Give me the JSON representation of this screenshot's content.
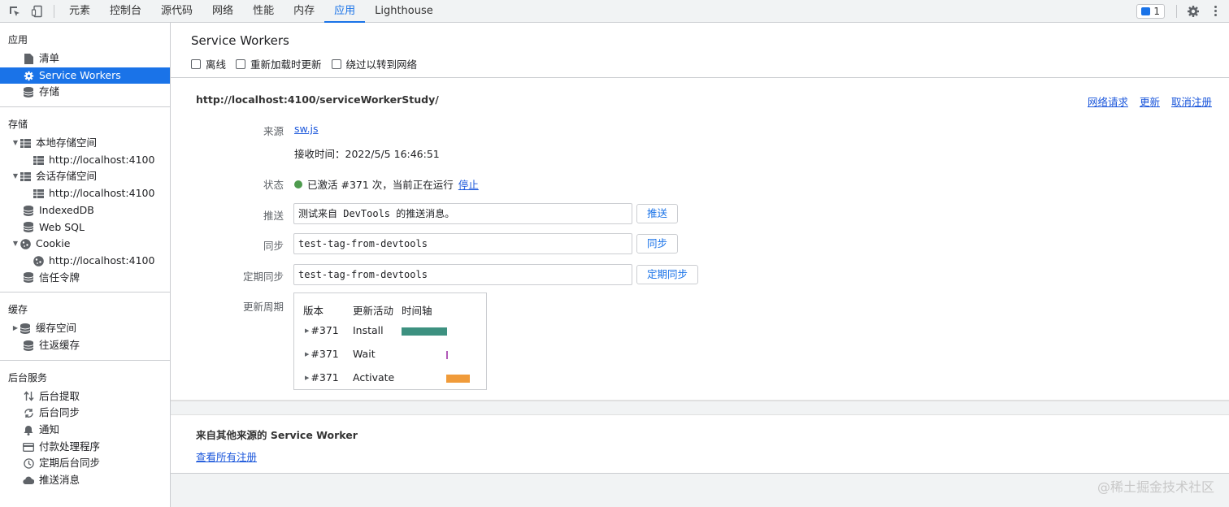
{
  "toolbar": {
    "tabs": [
      "元素",
      "控制台",
      "源代码",
      "网络",
      "性能",
      "内存",
      "应用",
      "Lighthouse"
    ],
    "active_tab": "应用",
    "issues_count": "1"
  },
  "sidebar": {
    "app_title": "应用",
    "app_items": [
      "清单",
      "Service Workers",
      "存储"
    ],
    "storage_title": "存储",
    "local_storage": "本地存储空间",
    "local_storage_child": "http://localhost:4100",
    "session_storage": "会话存储空间",
    "session_storage_child": "http://localhost:4100",
    "indexeddb": "IndexedDB",
    "websql": "Web SQL",
    "cookie": "Cookie",
    "cookie_child": "http://localhost:4100",
    "trust_tokens": "信任令牌",
    "cache_title": "缓存",
    "cache_storage": "缓存空间",
    "bfcache": "往返缓存",
    "bg_title": "后台服务",
    "bg_items": [
      "后台提取",
      "后台同步",
      "通知",
      "付款处理程序",
      "定期后台同步",
      "推送消息"
    ]
  },
  "main": {
    "title": "Service Workers",
    "checkboxes": [
      "离线",
      "重新加载时更新",
      "绕过以转到网络"
    ],
    "scope": "http://localhost:4100/serviceWorkerStudy/",
    "actions": [
      "网络请求",
      "更新",
      "取消注册"
    ],
    "source_label": "来源",
    "source_link": "sw.js",
    "received_label": "接收时间：2022/5/5 16:46:51",
    "status_label": "状态",
    "status_text": "已激活 #371 次，当前正在运行",
    "status_stop": "停止",
    "push_label": "推送",
    "push_value": "测试来自 DevTools 的推送消息。",
    "push_button": "推送",
    "sync_label": "同步",
    "sync_value": "test-tag-from-devtools",
    "sync_button": "同步",
    "periodic_label": "定期同步",
    "periodic_value": "test-tag-from-devtools",
    "periodic_button": "定期同步",
    "cycle_label": "更新周期",
    "cycle_headers": [
      "版本",
      "更新活动",
      "时间轴"
    ],
    "cycle_rows": [
      {
        "version": "#371",
        "activity": "Install",
        "color": "#3d9180"
      },
      {
        "version": "#371",
        "activity": "Wait",
        "color": "#b25bb8"
      },
      {
        "version": "#371",
        "activity": "Activate",
        "color": "#f09b3a"
      }
    ]
  },
  "other": {
    "title": "来自其他来源的 Service Worker",
    "link": "查看所有注册"
  },
  "watermark": "@稀土掘金技术社区"
}
